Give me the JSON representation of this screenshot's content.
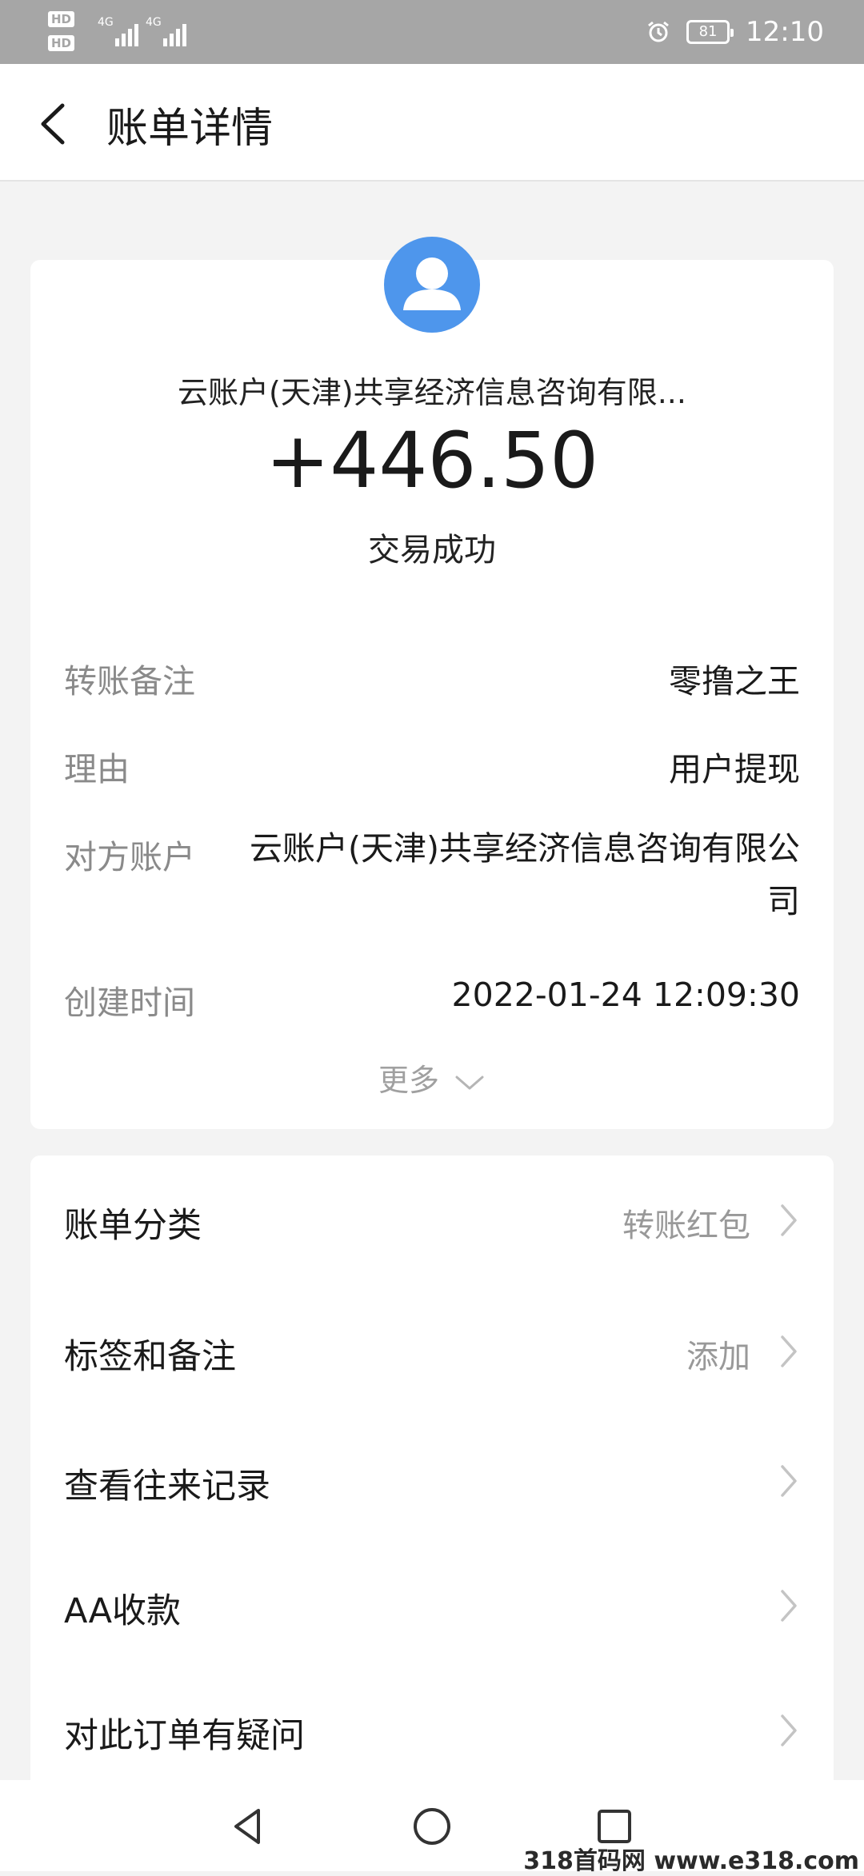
{
  "status_bar": {
    "sim1": "HD 1",
    "sim2": "HD 2",
    "network1": "4G",
    "network2": "4G",
    "battery": "81",
    "time": "12:10"
  },
  "header": {
    "title": "账单详情",
    "back_icon": "chevron-left-icon"
  },
  "summary": {
    "avatar_icon": "user-icon",
    "payee": "云账户(天津)共享经济信息咨询有限...",
    "amount": "+446.50",
    "status": "交易成功"
  },
  "details": [
    {
      "key": "转账备注",
      "value": "零撸之王"
    },
    {
      "key": "理由",
      "value": "用户提现"
    },
    {
      "key": "对方账户",
      "value": "云账户(天津)共享经济信息咨询有限公司"
    },
    {
      "key": "创建时间",
      "value": "2022-01-24 12:09:30"
    }
  ],
  "more_label": "更多",
  "actions": [
    {
      "label": "账单分类",
      "value": "转账红包"
    },
    {
      "label": "标签和备注",
      "value": "添加"
    },
    {
      "label": "查看往来记录",
      "value": ""
    },
    {
      "label": "AA收款",
      "value": ""
    },
    {
      "label": "对此订单有疑问",
      "value": ""
    }
  ],
  "watermark": "318首码网 www.e318.com",
  "colors": {
    "avatar": "#4e96ec",
    "status_bar": "#a6a6a6",
    "page_bg": "#f3f3f3"
  }
}
